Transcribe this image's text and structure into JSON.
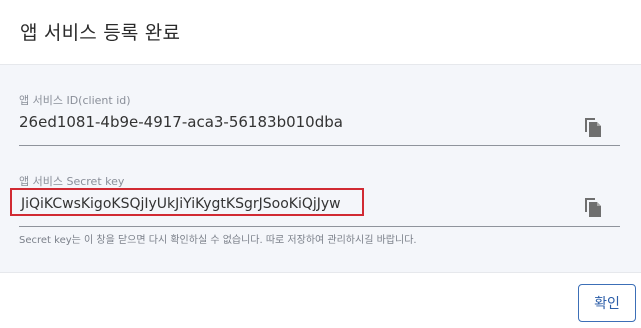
{
  "dialog": {
    "title": "앱 서비스 등록 완료"
  },
  "fields": {
    "app_service_id": {
      "label": "앱 서비스 ID(client id)",
      "value": "26ed1081-4b9e-4917-aca3-56183b010dba",
      "copy_icon": "copy-icon"
    },
    "secret_key": {
      "label": "앱 서비스 Secret key",
      "value": "JiQiKCwsKigoKSQjIyUkJiYiKygtKSgrJSooKiQjJyw",
      "copy_icon": "copy-icon",
      "highlight_color": "#d12a33"
    }
  },
  "helper_text": "Secret key는 이 창을 닫으면 다시 확인하실 수 없습니다. 따로 저장하여 관리하시길 바랍니다.",
  "footer": {
    "confirm_label": "확인"
  },
  "colors": {
    "accent": "#2c5ea8",
    "body_background": "#f4f6fa",
    "highlight": "#d12a33"
  }
}
